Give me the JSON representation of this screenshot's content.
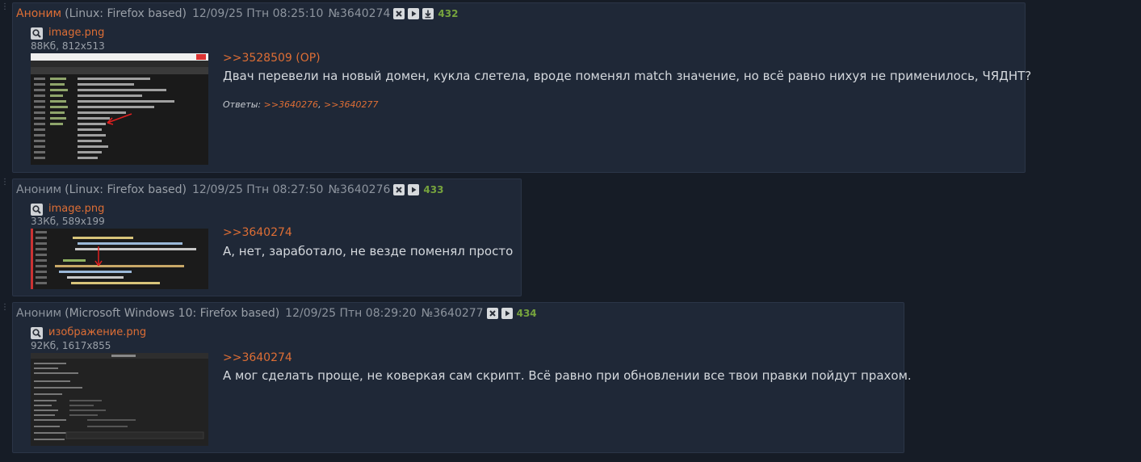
{
  "posts": [
    {
      "author": "Аноним",
      "system": "(Linux: Firefox based)",
      "date": "12/09/25 Птн 08:25:10",
      "number": "№3640274",
      "count": "432",
      "file": {
        "name": "image.png",
        "info": "88Кб, 812x513"
      },
      "reply_to": ">>3528509 (OP)",
      "text": "Двач перевели на новый домен, кукла слетела, вроде поменял match значение, но всё равно нихуя не применилось, ЧЯДНТ?",
      "answers_label": "Ответы:",
      "answers": [
        ">>3640276",
        ">>3640277"
      ],
      "answers_sep": ","
    },
    {
      "author": "Аноним",
      "system": "(Linux: Firefox based)",
      "date": "12/09/25 Птн 08:27:50",
      "number": "№3640276",
      "count": "433",
      "file": {
        "name": "image.png",
        "info": "33Кб, 589x199"
      },
      "reply_to": ">>3640274",
      "text": "А, нет, заработало, не везде поменял просто"
    },
    {
      "author": "Аноним",
      "system": "(Microsoft Windows 10: Firefox based)",
      "date": "12/09/25 Птн 08:29:20",
      "number": "№3640277",
      "count": "434",
      "file": {
        "name": "изображение.png",
        "info": "92Кб, 1617x855"
      },
      "reply_to": ">>3640274",
      "text": "А мог сделать проще, не коверкая сам скрипт. Всё равно при обновлении все твои правки пойдут прахом."
    }
  ],
  "icons": {
    "hide": "close-icon",
    "play": "play-icon",
    "download": "download-icon",
    "search": "search-icon"
  },
  "colors": {
    "background": "#161c26",
    "post_bg": "#1f2837",
    "accent": "#de6e35",
    "count": "#76a33d"
  }
}
